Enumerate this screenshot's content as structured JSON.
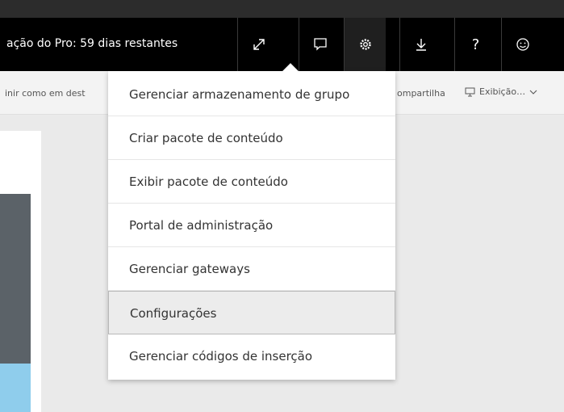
{
  "topbar": {
    "trial_text": "ação do Pro: 59 dias restantes",
    "icons": [
      "expand-icon",
      "comment-icon",
      "gear-icon",
      "download-icon",
      "help-icon",
      "smiley-icon"
    ],
    "help_glyph": "?"
  },
  "subbar": {
    "left_text": "inir como em dest",
    "share_text": "ompartilha",
    "view_text": "Exibição…"
  },
  "settings_menu": {
    "items": [
      "Gerenciar armazenamento de grupo",
      "Criar pacote de conteúdo",
      "Exibir pacote de conteúdo",
      "Portal de administração",
      "Gerenciar gateways",
      "Configurações",
      "Gerenciar códigos de inserção"
    ],
    "selected_index": 5
  },
  "colors": {
    "topbar_bg": "#000000",
    "menu_bg": "#ffffff",
    "selected_bg": "#ececec",
    "canvas_bg": "#eaeaea",
    "tile_dark": "#5b6268",
    "tile_light": "#8fcdec"
  }
}
